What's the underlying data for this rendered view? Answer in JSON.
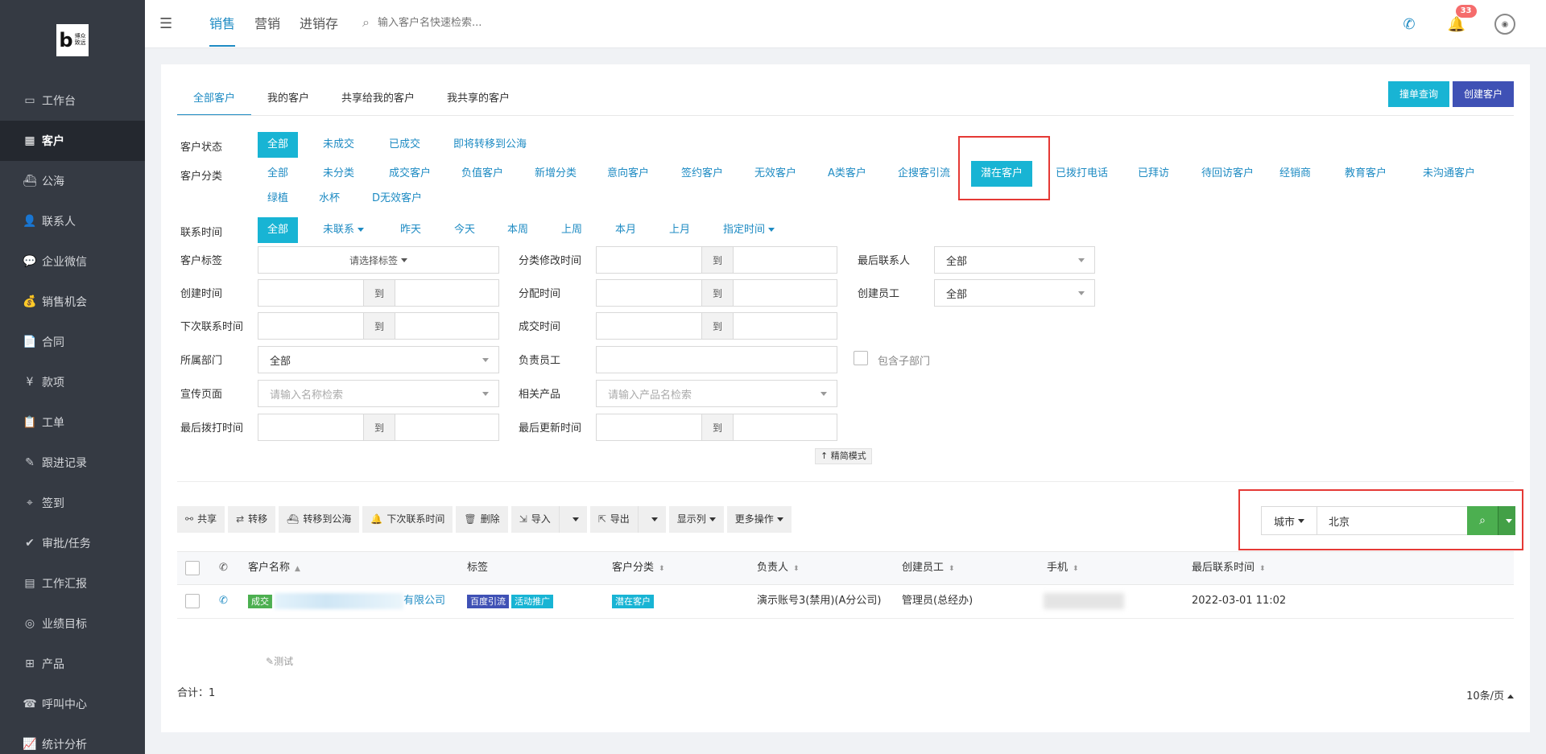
{
  "sidebar": {
    "logo": {
      "letter": "b",
      "text": "博众\n致远"
    },
    "items": [
      {
        "label": "工作台",
        "icon": "desktop-icon",
        "glyph": "▭"
      },
      {
        "label": "客户",
        "icon": "building-icon",
        "glyph": "▦"
      },
      {
        "label": "公海",
        "icon": "ship-icon",
        "glyph": "⛴"
      },
      {
        "label": "联系人",
        "icon": "user-icon",
        "glyph": "👤"
      },
      {
        "label": "企业微信",
        "icon": "chat-icon",
        "glyph": "💬"
      },
      {
        "label": "销售机会",
        "icon": "moneybag-icon",
        "glyph": "💰"
      },
      {
        "label": "合同",
        "icon": "contract-icon",
        "glyph": "📄"
      },
      {
        "label": "款项",
        "icon": "payment-icon",
        "glyph": "¥"
      },
      {
        "label": "工单",
        "icon": "clipboard-icon",
        "glyph": "📋"
      },
      {
        "label": "跟进记录",
        "icon": "edit-icon",
        "glyph": "✎"
      },
      {
        "label": "签到",
        "icon": "location-icon",
        "glyph": "⌖"
      },
      {
        "label": "审批/任务",
        "icon": "approval-icon",
        "glyph": "✔"
      },
      {
        "label": "工作汇报",
        "icon": "report-icon",
        "glyph": "▤"
      },
      {
        "label": "业绩目标",
        "icon": "target-icon",
        "glyph": "◎"
      },
      {
        "label": "产品",
        "icon": "grid-icon",
        "glyph": "⊞"
      },
      {
        "label": "呼叫中心",
        "icon": "phone-icon",
        "glyph": "☎"
      },
      {
        "label": "统计分析",
        "icon": "chart-icon",
        "glyph": "📈"
      }
    ],
    "active_index": 1
  },
  "topbar": {
    "tabs": [
      "销售",
      "营销",
      "进销存"
    ],
    "active_tab": 0,
    "search_placeholder": "输入客户名快速检索...",
    "notification_count": "33"
  },
  "customer_tabs": [
    "全部客户",
    "我的客户",
    "共享给我的客户",
    "我共享的客户"
  ],
  "header_buttons": {
    "check": "撞单查询",
    "create": "创建客户"
  },
  "filters": {
    "status_label": "客户状态",
    "status_options": [
      "全部",
      "未成交",
      "已成交",
      "即将转移到公海"
    ],
    "category_label": "客户分类",
    "category_row1": [
      "全部",
      "未分类",
      "成交客户",
      "负值客户",
      "新增分类",
      "意向客户",
      "签约客户",
      "无效客户",
      "A类客户",
      "企搜客引流",
      "潜在客户",
      "已拨打电话",
      "已拜访",
      "待回访客户",
      "经销商",
      "教育客户",
      "未沟通客户"
    ],
    "category_row2": [
      "绿植",
      "水杯",
      "D无效客户"
    ],
    "contact_label": "联系时间",
    "contact_options": [
      "全部",
      "未联系",
      "昨天",
      "今天",
      "本周",
      "上周",
      "本月",
      "上月",
      "指定时间"
    ],
    "tag_label": "客户标签",
    "tag_placeholder": "请选择标签",
    "category_modified_label": "分类修改时间",
    "last_contact_person_label": "最后联系人",
    "last_contact_person_value": "全部",
    "created_time_label": "创建时间",
    "assigned_time_label": "分配时间",
    "creator_label": "创建员工",
    "creator_value": "全部",
    "next_contact_label": "下次联系时间",
    "deal_time_label": "成交时间",
    "department_label": "所属部门",
    "department_value": "全部",
    "owner_label": "负责员工",
    "include_sub_label": "包含子部门",
    "promo_page_label": "宣传页面",
    "promo_page_placeholder": "请输入名称检索",
    "product_label": "相关产品",
    "product_placeholder": "请输入产品名检索",
    "last_call_label": "最后拨打时间",
    "last_update_label": "最后更新时间",
    "to": "到",
    "simple_mode": "↑ 精简模式"
  },
  "toolbar": [
    {
      "label": "共享",
      "icon": "share-icon",
      "glyph": "⚯"
    },
    {
      "label": "转移",
      "icon": "transfer-icon",
      "glyph": "⇄"
    },
    {
      "label": "转移到公海",
      "icon": "ship-icon",
      "glyph": "⛴"
    },
    {
      "label": "下次联系时间",
      "icon": "bell-icon",
      "glyph": "🔔"
    },
    {
      "label": "删除",
      "icon": "trash-icon",
      "glyph": "🗑"
    },
    {
      "label": "导入",
      "icon": "import-icon",
      "glyph": "⇲"
    },
    {
      "label": "导出",
      "icon": "export-icon",
      "glyph": "⇱"
    },
    {
      "label": "显示列",
      "icon": "",
      "glyph": ""
    },
    {
      "label": "更多操作",
      "icon": "",
      "glyph": ""
    }
  ],
  "search_combo": {
    "field": "城市",
    "value": "北京"
  },
  "table": {
    "headers": [
      "客户名称",
      "标签",
      "客户分类",
      "负责人",
      "创建员工",
      "手机",
      "最后联系时间"
    ],
    "rows": [
      {
        "status": "成交",
        "name_suffix": "有限公司",
        "tags": [
          "百度引流",
          "活动推广"
        ],
        "category": "潜在客户",
        "owner": "演示账号3(禁用)(A分公司)",
        "creator": "管理员(总经办)",
        "last_contact": "2022-03-01 11:02",
        "note": "测试"
      }
    ]
  },
  "footer": {
    "total_label": "合计：",
    "total": "1",
    "page_size": "10条/页"
  },
  "colors": {
    "sidebar": "#353a43",
    "accent": "#18b4d4",
    "link": "#1e8bc3",
    "primary": "#3f51b5",
    "highlight_border": "#e53935"
  }
}
